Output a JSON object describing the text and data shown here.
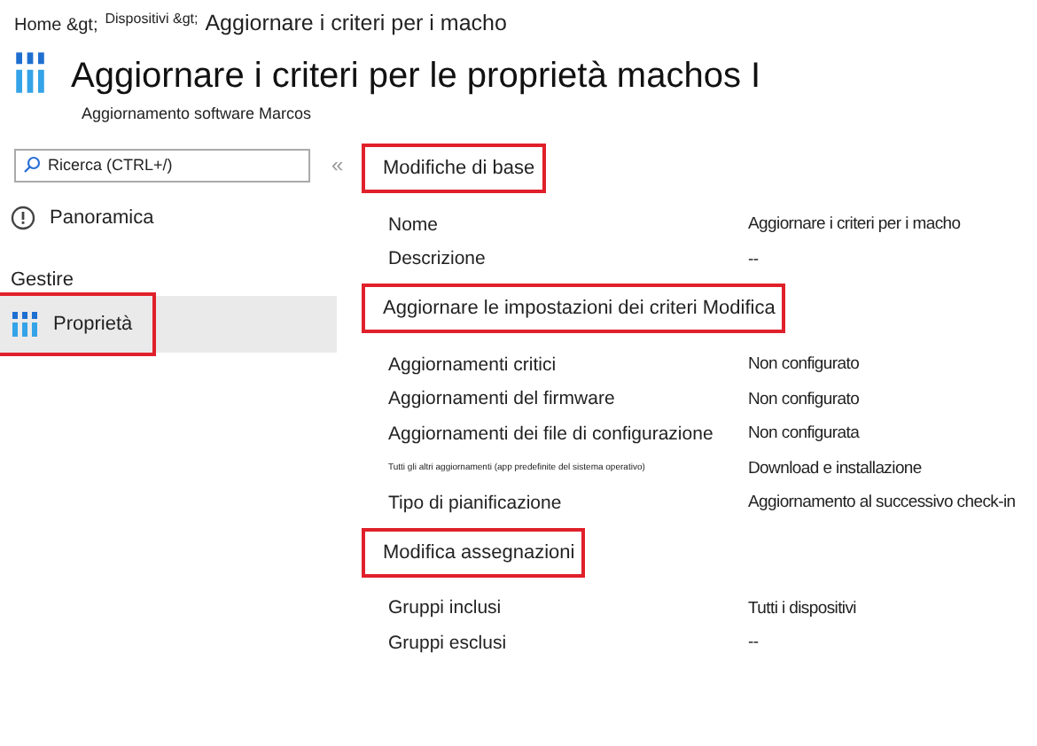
{
  "breadcrumb": [
    "Home &gt;",
    "Dispositivi &gt;",
    "Aggiornare i criteri per i macho"
  ],
  "header": {
    "title": "Aggiornare i criteri per le proprietà machos I",
    "subtitle": "Aggiornamento software Marcos"
  },
  "sidebar": {
    "search": {
      "placeholder": "Ricerca (CTRL+/)"
    },
    "collapse": "«",
    "items": [
      {
        "kind": "info-link",
        "label": "Panoramica",
        "selected": false,
        "highlighted": false
      },
      {
        "kind": "group",
        "label": "Gestire"
      },
      {
        "kind": "bars-link",
        "label": "Proprietà",
        "selected": true,
        "highlighted": true
      }
    ]
  },
  "sections": [
    {
      "title": "Modifiche di base",
      "highlighted": true,
      "rows": [
        {
          "kind": "standard",
          "label": "Nome",
          "value": "Aggiornare i criteri per i macho"
        },
        {
          "kind": "standard",
          "label": "Descrizione",
          "value": "--"
        }
      ]
    },
    {
      "title": "Aggiornare le impostazioni dei criteri Modifica",
      "highlighted": true,
      "rows": [
        {
          "kind": "standard",
          "label": "Aggiornamenti critici",
          "value": "Non configurato"
        },
        {
          "kind": "standard",
          "label": "Aggiornamenti del firmware",
          "value": "Non configurato"
        },
        {
          "kind": "standard",
          "label": "Aggiornamenti dei file di configurazione",
          "value": "Non configurata"
        },
        {
          "kind": "fine-print",
          "label": "Tutti gli altri aggiornamenti (app predefinite del sistema operativo)",
          "value": "Download e installazione"
        },
        {
          "kind": "standard",
          "label": "Tipo di pianificazione",
          "value": "Aggiornamento al successivo check-in"
        }
      ]
    },
    {
      "title": "Modifica assegnazioni",
      "highlighted": true,
      "rows": [
        {
          "kind": "standard",
          "label": "Gruppi inclusi",
          "value": "Tutti i dispositivi"
        },
        {
          "kind": "standard",
          "label": "Gruppi esclusi",
          "value": "--"
        }
      ]
    }
  ]
}
